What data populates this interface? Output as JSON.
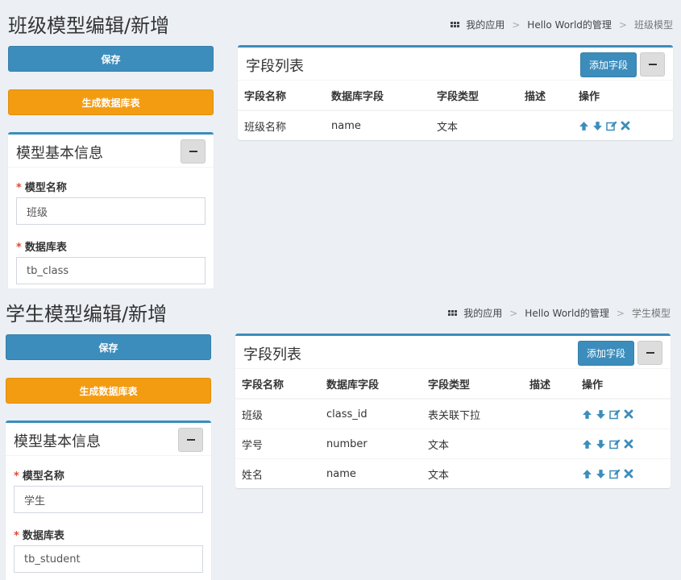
{
  "panels": [
    {
      "page_title": "班级模型编辑/新增",
      "breadcrumb": [
        "我的应用",
        "Hello World的管理",
        "班级模型"
      ],
      "save_label": "保存",
      "generate_label": "生成数据库表",
      "info_box": {
        "title": "模型基本信息",
        "model_name_label": "模型名称",
        "model_name_value": "班级",
        "db_table_label": "数据库表",
        "db_table_value": "tb_class"
      },
      "fields_box": {
        "title": "字段列表",
        "add_label": "添加字段",
        "columns": [
          "字段名称",
          "数据库字段",
          "字段类型",
          "描述",
          "操作"
        ],
        "rows": [
          {
            "name": "班级名称",
            "db_field": "name",
            "type": "文本",
            "desc": ""
          }
        ]
      }
    },
    {
      "page_title": "学生模型编辑/新增",
      "breadcrumb": [
        "我的应用",
        "Hello World的管理",
        "学生模型"
      ],
      "save_label": "保存",
      "generate_label": "生成数据库表",
      "info_box": {
        "title": "模型基本信息",
        "model_name_label": "模型名称",
        "model_name_value": "学生",
        "db_table_label": "数据库表",
        "db_table_value": "tb_student"
      },
      "fields_box": {
        "title": "字段列表",
        "add_label": "添加字段",
        "columns": [
          "字段名称",
          "数据库字段",
          "字段类型",
          "描述",
          "操作"
        ],
        "rows": [
          {
            "name": "班级",
            "db_field": "class_id",
            "type": "表关联下拉",
            "desc": ""
          },
          {
            "name": "学号",
            "db_field": "number",
            "type": "文本",
            "desc": ""
          },
          {
            "name": "姓名",
            "db_field": "name",
            "type": "文本",
            "desc": ""
          }
        ]
      }
    }
  ],
  "colors": {
    "primary": "#3c8dbc",
    "warning": "#f39c12",
    "background": "#ecf0f5",
    "required": "#dd4b39"
  },
  "icons": [
    "grid-icon",
    "minus-icon",
    "arrow-up-icon",
    "arrow-down-icon",
    "edit-icon",
    "delete-icon"
  ]
}
